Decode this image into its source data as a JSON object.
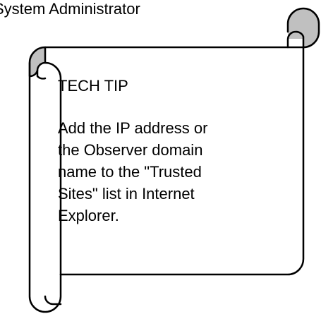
{
  "caption": "System Administrator",
  "scroll": {
    "heading": "TECH TIP",
    "body": "Add the IP address or\nthe Observer domain\nname to the \"Trusted\nSites\" list in Internet\nExplorer."
  },
  "colors": {
    "background": "#ffffff",
    "scroll_fill": "#ffffff",
    "scroll_curl_shade": "#c0c0c0",
    "outline": "#000000",
    "text": "#000000"
  },
  "icons": {
    "scroll": "horizontal-scroll-shape"
  }
}
